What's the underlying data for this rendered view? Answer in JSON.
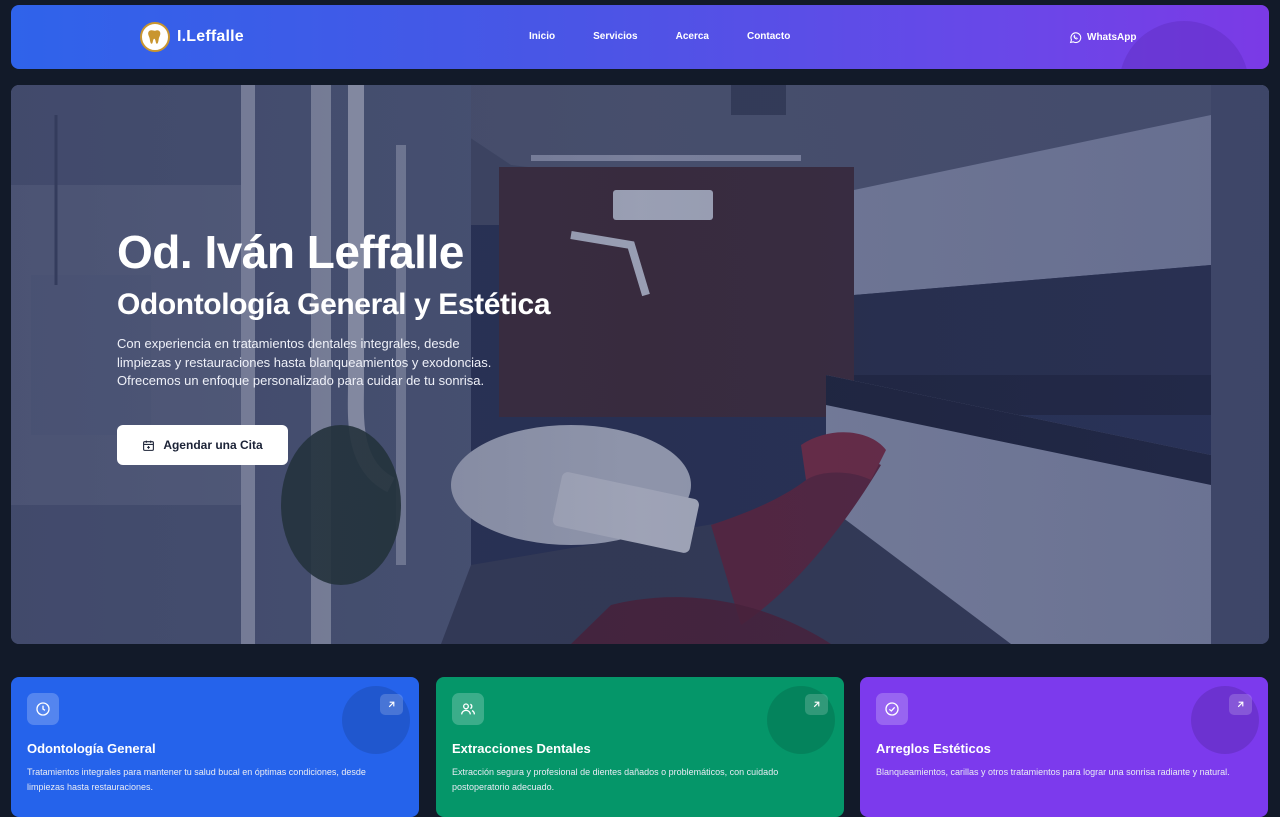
{
  "brand": {
    "name": "I.Leffalle",
    "logo_icon": "tooth-icon"
  },
  "nav": {
    "links": [
      "Inicio",
      "Servicios",
      "Acerca",
      "Contacto"
    ],
    "whatsapp_label": "WhatsApp"
  },
  "hero": {
    "title": "Od. Iván Leffalle",
    "subtitle": "Odontología General y Estética",
    "description": "Con experiencia en tratamientos dentales integrales, desde limpiezas y restauraciones hasta blanqueamientos y exodoncias. Ofrecemos un enfoque personalizado para cuidar de tu sonrisa.",
    "cta_label": "Agendar una Cita",
    "cta_icon": "calendar-icon"
  },
  "services": [
    {
      "title": "Odontología General",
      "description": "Tratamientos integrales para mantener tu salud bucal en óptimas condiciones, desde limpiezas hasta restauraciones.",
      "icon": "clock-icon",
      "color": "#2563eb"
    },
    {
      "title": "Extracciones Dentales",
      "description": "Extracción segura y profesional de dientes dañados o problemáticos, con cuidado postoperatorio adecuado.",
      "icon": "users-icon",
      "color": "#059669"
    },
    {
      "title": "Arreglos Estéticos",
      "description": "Blanqueamientos, carillas y otros tratamientos para lograr una sonrisa radiante y natural.",
      "icon": "check-circle-icon",
      "color": "#7c3aed"
    }
  ],
  "colors": {
    "page_bg": "#121a29",
    "nav_gradient_start": "#2f63ea",
    "nav_gradient_end": "#7b3ae6"
  }
}
